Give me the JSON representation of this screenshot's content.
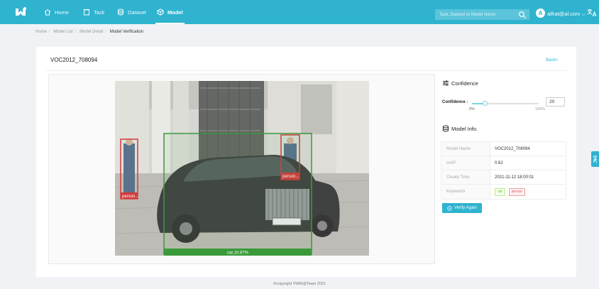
{
  "nav": {
    "items": [
      {
        "label": "Home",
        "icon": "home-icon"
      },
      {
        "label": "Task",
        "icon": "task-icon"
      },
      {
        "label": "Dataset",
        "icon": "dataset-icon"
      },
      {
        "label": "Model",
        "icon": "model-icon",
        "active": true
      }
    ],
    "search_placeholder": "Task, Dataset or Model Name",
    "avatar_letter": "A",
    "user": "alfrat@al.com",
    "accent": "#2fb3cf"
  },
  "breadcrumb": [
    "Home",
    "Model List",
    "Model Detail",
    "Model Verification"
  ],
  "page": {
    "title": "VOC2012_708094",
    "back_label": "Back>"
  },
  "detections": [
    {
      "label": "person...",
      "color": "#d23c3c"
    },
    {
      "label": "person...",
      "color": "#d23c3c"
    },
    {
      "label": "car,10.87%",
      "color": "#3a9a3a"
    }
  ],
  "confidence": {
    "title": "Confidence",
    "label": "Confidence :",
    "value": "20",
    "fraction": 0.2,
    "min_label": "0%",
    "max_label": "100%"
  },
  "model_info": {
    "title": "Model Info.",
    "rows": [
      {
        "key": "Model Name",
        "value": "VOC2012_708094"
      },
      {
        "key": "mAP",
        "value": "0.62"
      },
      {
        "key": "Create Time",
        "value": "2021-11-12 18:00:01"
      },
      {
        "key": "Keywords",
        "value": ""
      }
    ],
    "keywords": [
      "car",
      "person"
    ]
  },
  "verify_label": "Verify Again",
  "footer": "©copyright YMIR@Team 2021"
}
